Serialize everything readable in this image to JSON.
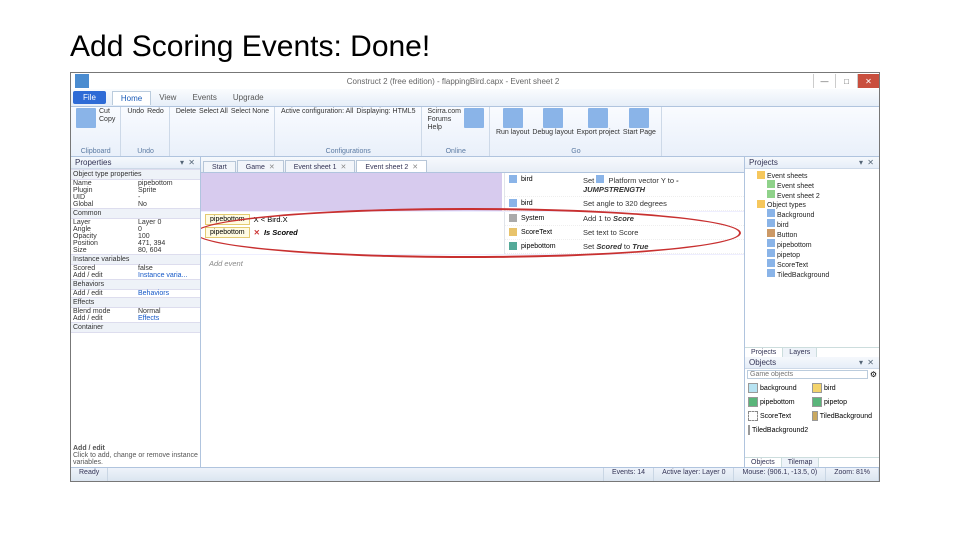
{
  "slide": {
    "title": "Add Scoring Events: Done!"
  },
  "window": {
    "title": "Construct 2 (free edition) - flappingBird.capx - Event sheet 2",
    "min": "—",
    "max": "□",
    "close": "✕"
  },
  "menu": {
    "file": "File",
    "tabs": [
      "Home",
      "View",
      "Events",
      "Upgrade"
    ]
  },
  "ribbon": {
    "clipboard": {
      "label": "Clipboard",
      "paste": "Paste",
      "cut": "Cut",
      "copy": "Copy"
    },
    "undo": {
      "label": "Undo",
      "undo": "Undo",
      "redo": "Redo"
    },
    "select": {
      "label": "",
      "delete": "Delete",
      "selectall": "Select All",
      "selectnone": "Select None"
    },
    "config": {
      "label": "Configurations",
      "active": "Active configuration: All",
      "display": "Displaying: HTML5"
    },
    "online": {
      "label": "Online",
      "scirra": "Scirra.com",
      "forums": "Forums",
      "help": "Help",
      "store": "Scirra Store"
    },
    "go": {
      "label": "Go",
      "run": "Run layout",
      "debug": "Debug layout",
      "export": "Export project",
      "start": "Start Page"
    }
  },
  "properties": {
    "header": "Properties",
    "px": "▾ ✕",
    "g1": "Object type properties",
    "name_k": "Name",
    "name_v": "pipebottom",
    "plugin_k": "Plugin",
    "plugin_v": "Sprite",
    "uid_k": "UID",
    "uid_v": "-",
    "global_k": "Global",
    "global_v": "No",
    "g2": "Common",
    "layer_k": "Layer",
    "layer_v": "Layer 0",
    "angle_k": "Angle",
    "angle_v": "0",
    "opacity_k": "Opacity",
    "opacity_v": "100",
    "position_k": "Position",
    "position_v": "471, 394",
    "size_k": "Size",
    "size_v": "80, 604",
    "g3": "Instance variables",
    "scored_k": "Scored",
    "scored_v": "false",
    "addedit1_k": "Add / edit",
    "addedit1_v": "Instance varia...",
    "g4": "Behaviors",
    "addedit2_k": "Add / edit",
    "addedit2_v": "Behaviors",
    "g5": "Effects",
    "blend_k": "Blend mode",
    "blend_v": "Normal",
    "addedit3_k": "Add / edit",
    "addedit3_v": "Effects",
    "g6": "Container",
    "hint_title": "Add / edit",
    "hint_text": "Click to add, change or remove instance variables."
  },
  "centertabs": [
    "Start",
    "Game",
    "Event sheet 1",
    "Event sheet 2"
  ],
  "events": {
    "e1": {
      "obj": "bird",
      "obj2": "bird",
      "a1": "Set",
      "a1b": "Platform",
      "a1t": "vector Y to",
      "a1v": "-JUMPSTRENGTH",
      "a2": "Set angle to 320 degrees"
    },
    "e2": {
      "c1": "pipebottom",
      "c1t": "X < Bird.X",
      "c2": "pipebottom",
      "c2t": "Is Scored",
      "c2x": "✕",
      "a1o": "System",
      "a1": "Add 1 to",
      "a1b": "Score",
      "a2o": "ScoreText",
      "a2": "Set text to Score",
      "a3o": "pipebottom",
      "a3": "Set",
      "a3b": "Scored",
      "a3t": "to",
      "a3v": "True"
    },
    "addevent": "Add event"
  },
  "projects": {
    "header": "Projects",
    "px": "▾ ✕",
    "n1": "Event sheets",
    "n1a": "Event sheet",
    "n1b": "Event sheet 2",
    "n2": "Object types",
    "n2a": "Background",
    "n2b": "bird",
    "n2c": "Button",
    "n2d": "pipebottom",
    "n2e": "pipetop",
    "n2f": "ScoreText",
    "n2g": "TiledBackground",
    "tabs": [
      "Projects",
      "Layers"
    ]
  },
  "objects": {
    "header": "Objects",
    "px": "▾ ✕",
    "placeholder": "Game objects",
    "gear": "⚙",
    "items": [
      "background",
      "bird",
      "pipebottom",
      "pipetop",
      "ScoreText",
      "TiledBackground",
      "TiledBackground2"
    ],
    "tabs": [
      "Objects",
      "Tilemap"
    ]
  },
  "status": {
    "ready": "Ready",
    "events": "Events: 14",
    "layer": "Active layer: Layer 0",
    "mouse": "Mouse: (906.1, -13.5, 0)",
    "zoom": "Zoom: 81%"
  }
}
